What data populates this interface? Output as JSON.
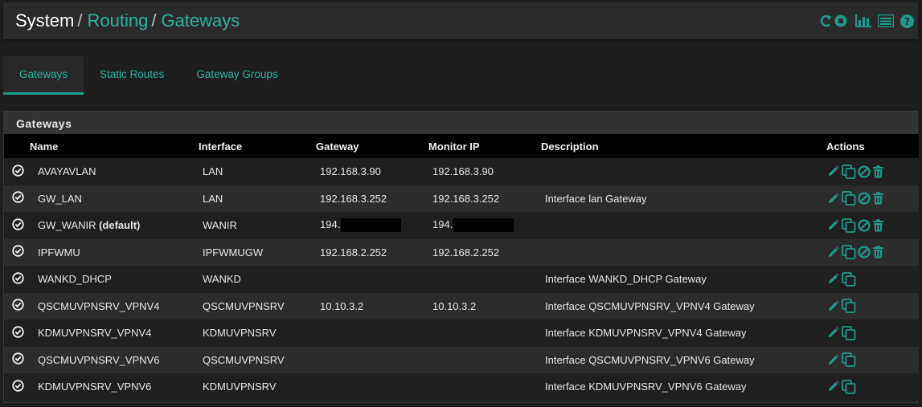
{
  "breadcrumb": {
    "root": "System",
    "sep1": "/",
    "middle": "Routing",
    "sep2": "/",
    "current": "Gateways"
  },
  "top_icons": [
    "reload-stop-icon",
    "bar-chart-icon",
    "list-icon",
    "help-icon"
  ],
  "tabs": [
    {
      "label": "Gateways",
      "active": true
    },
    {
      "label": "Static Routes",
      "active": false
    },
    {
      "label": "Gateway Groups",
      "active": false
    }
  ],
  "panel": {
    "title": "Gateways",
    "columns": {
      "name": "Name",
      "interface": "Interface",
      "gateway": "Gateway",
      "monitor": "Monitor IP",
      "description": "Description",
      "actions": "Actions"
    },
    "rows": [
      {
        "name": "AVAYAVLAN",
        "default_label": "",
        "interface": "LAN",
        "gateway": "192.168.3.90",
        "monitor": "192.168.3.90",
        "description": ""
      },
      {
        "name": "GW_LAN",
        "default_label": "",
        "interface": "LAN",
        "gateway": "192.168.3.252",
        "monitor": "192.168.3.252",
        "description": "Interface lan Gateway"
      },
      {
        "name": "GW_WANIR",
        "default_label": "(default)",
        "interface": "WANIR",
        "gateway": "194.",
        "monitor": "194.",
        "description": ""
      },
      {
        "name": "IPFWMU",
        "default_label": "",
        "interface": "IPFWMUGW",
        "gateway": "192.168.2.252",
        "monitor": "192.168.2.252",
        "description": ""
      },
      {
        "name": "WANKD_DHCP",
        "default_label": "",
        "interface": "WANKD",
        "gateway": "",
        "monitor": "",
        "description": "Interface WANKD_DHCP Gateway"
      },
      {
        "name": "QSCMUVPNSRV_VPNV4",
        "default_label": "",
        "interface": "QSCMUVPNSRV",
        "gateway": "10.10.3.2",
        "monitor": "10.10.3.2",
        "description": "Interface QSCMUVPNSRV_VPNV4 Gateway"
      },
      {
        "name": "KDMUVPNSRV_VPNV4",
        "default_label": "",
        "interface": "KDMUVPNSRV",
        "gateway": "",
        "monitor": "",
        "description": "Interface KDMUVPNSRV_VPNV4 Gateway"
      },
      {
        "name": "QSCMUVPNSRV_VPNV6",
        "default_label": "",
        "interface": "QSCMUVPNSRV",
        "gateway": "",
        "monitor": "",
        "description": "Interface QSCMUVPNSRV_VPNV6 Gateway"
      },
      {
        "name": "KDMUVPNSRV_VPNV6",
        "default_label": "",
        "interface": "KDMUVPNSRV",
        "gateway": "",
        "monitor": "",
        "description": "Interface KDMUVPNSRV_VPNV6 Gateway"
      }
    ]
  },
  "colors": {
    "accent": "#2bb3a1",
    "icon": "#1f9a8a",
    "background": "#1d1d1d"
  }
}
